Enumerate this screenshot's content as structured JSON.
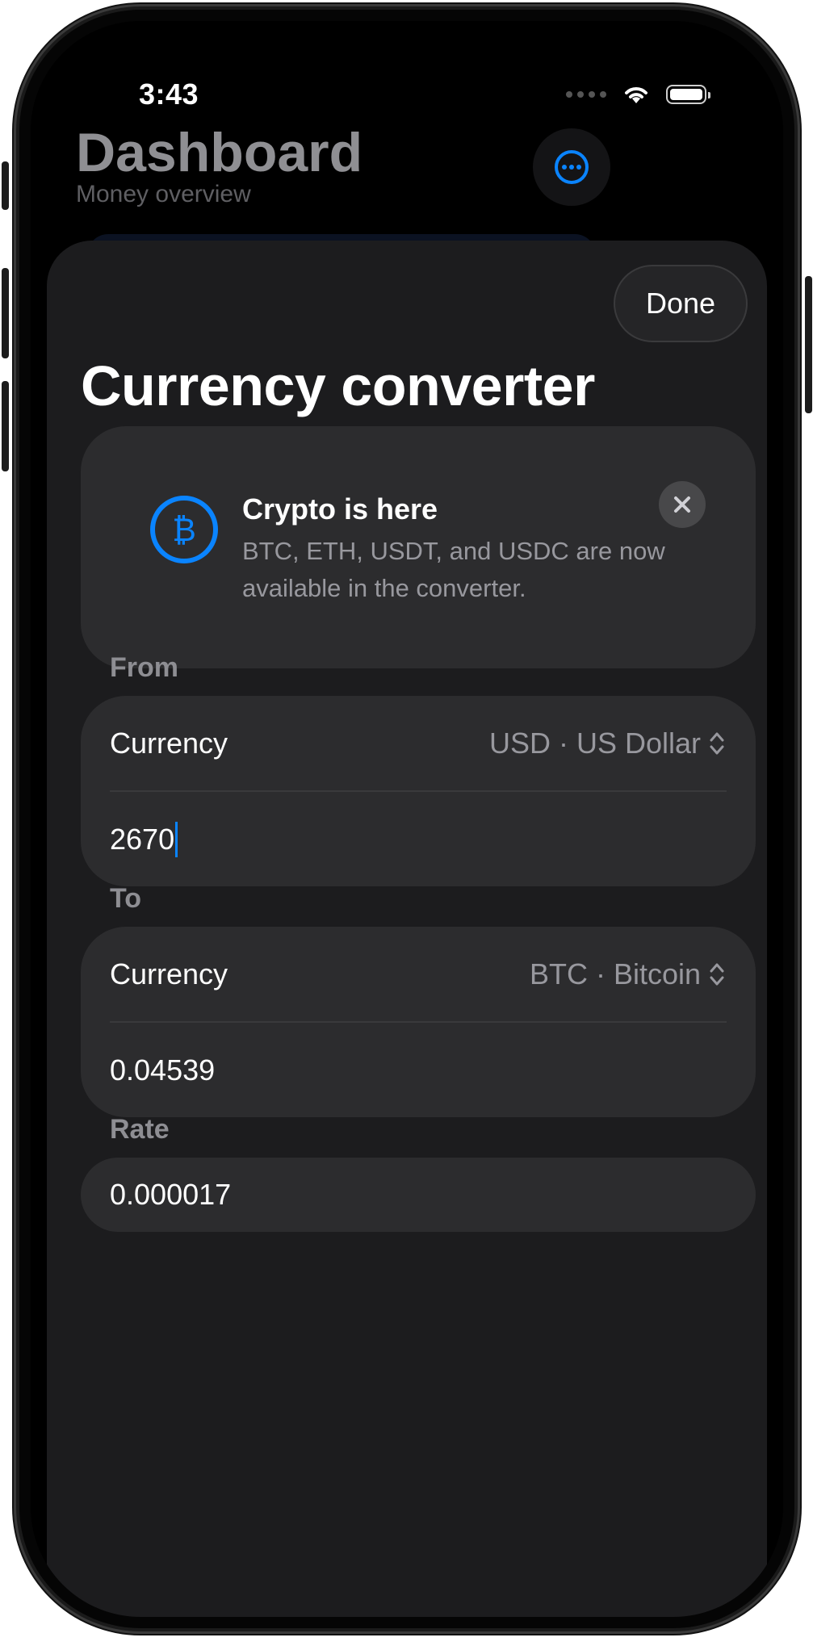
{
  "status_bar": {
    "time": "3:43",
    "icons": [
      "signal-dots-icon",
      "wifi-icon",
      "battery-icon"
    ]
  },
  "background_screen": {
    "title": "Dashboard",
    "subtitle": "Money overview",
    "more_icon": "ellipsis-circle-icon"
  },
  "sheet": {
    "done_label": "Done",
    "title": "Currency converter",
    "promo": {
      "icon": "bitcoin-icon",
      "title": "Crypto is here",
      "body": "BTC, ETH, USDT, and USDC are now available in the converter.",
      "close_icon": "close-icon"
    },
    "from": {
      "section_label": "From",
      "currency_label": "Currency",
      "currency_value": "USD · US Dollar",
      "amount": "2670"
    },
    "to": {
      "section_label": "To",
      "currency_label": "Currency",
      "currency_value": "BTC · Bitcoin",
      "amount": "0.04539"
    },
    "rate": {
      "section_label": "Rate",
      "value": "0.000017"
    }
  },
  "colors": {
    "accent": "#0a84ff",
    "sheet_bg": "#1c1c1e",
    "card_bg": "#2c2c2e",
    "secondary_text": "#98989e"
  }
}
